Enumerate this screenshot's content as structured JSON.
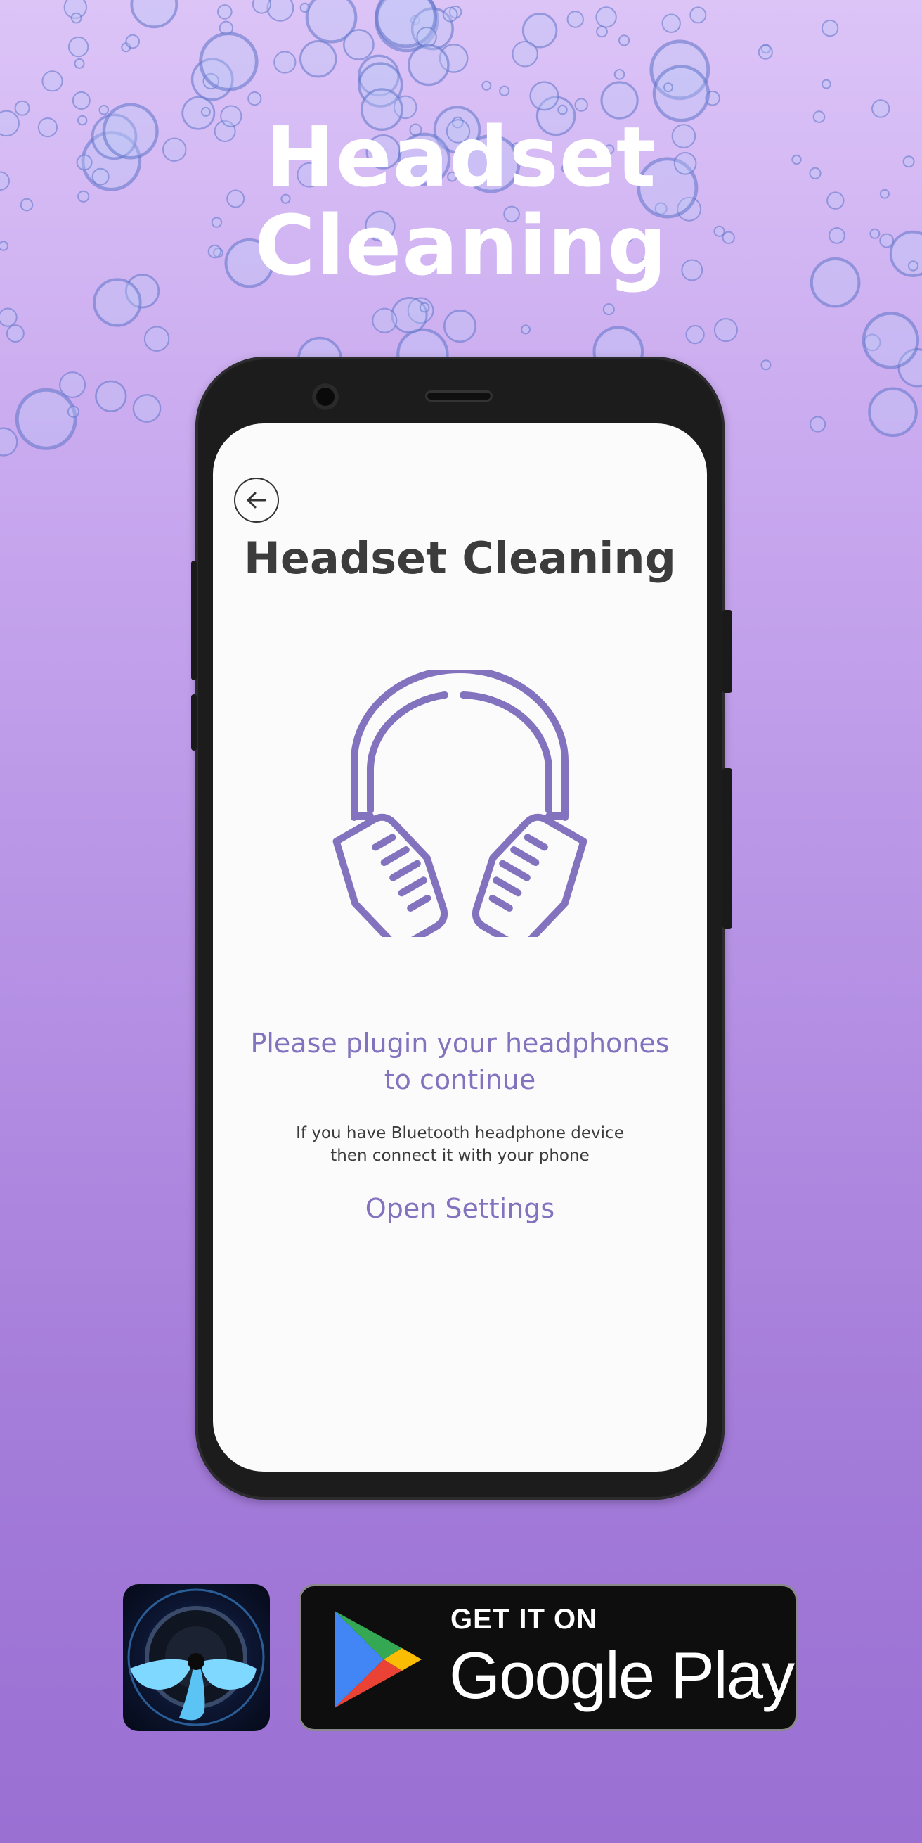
{
  "hero": {
    "title_line1": "Headset",
    "title_line2": "Cleaning"
  },
  "screen": {
    "back_icon": "arrow-left-icon",
    "title": "Headset Cleaning",
    "illustration_icon": "headphones-icon",
    "prompt_line1": "Please plugin your headphones",
    "prompt_line2": "to continue",
    "hint_line1": "If you have Bluetooth headphone device",
    "hint_line2": "then connect it with your phone",
    "open_settings_label": "Open Settings"
  },
  "store_badge": {
    "top_text": "GET IT ON",
    "main_text": "Google Play"
  },
  "colors": {
    "accent": "#8373bf",
    "title_text": "#3c3c3c",
    "background_top": "#dcc4f7",
    "background_bottom": "#9a70d3"
  }
}
